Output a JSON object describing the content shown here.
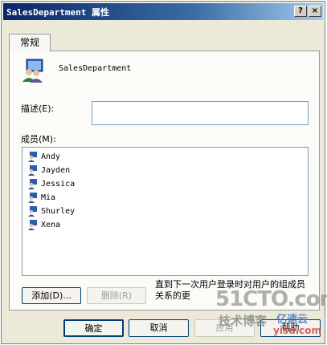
{
  "window": {
    "title": "SalesDepartment 属性",
    "help_button": "?",
    "close_button": "×"
  },
  "tabs": [
    {
      "label": "常规"
    }
  ],
  "general": {
    "group_name": "SalesDepartment",
    "description_label": "描述(E):",
    "description_value": "",
    "members_label": "成员(M):",
    "members": [
      {
        "name": "Andy"
      },
      {
        "name": "Jayden"
      },
      {
        "name": "Jessica"
      },
      {
        "name": "Mia"
      },
      {
        "name": "Shurley"
      },
      {
        "name": "Xena"
      }
    ],
    "add_button": "添加(D)...",
    "remove_button": "删除(R)",
    "note": "直到下一次用户登录时对用户的组成员关系的更"
  },
  "footer": {
    "ok": "确定",
    "cancel": "取消",
    "apply": "应用",
    "help": "帮助"
  },
  "watermark": {
    "line1": "51CTO.com",
    "line2": "技术博客",
    "line3": "亿速云",
    "line4": "yisu.com"
  }
}
